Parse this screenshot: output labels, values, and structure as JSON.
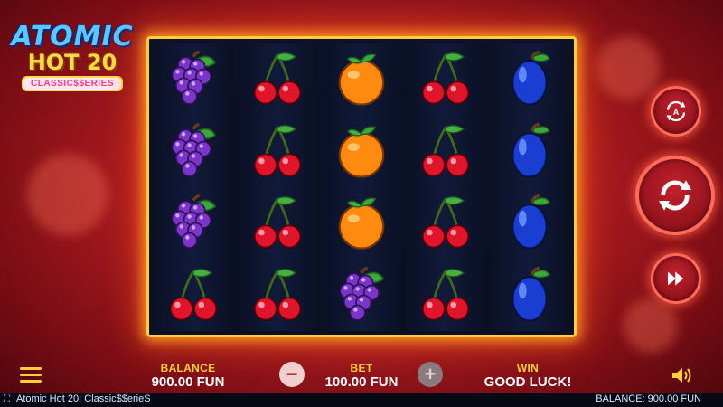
{
  "logo": {
    "line1": "ATOMIC",
    "line2": "HOT 20",
    "line3": "CLASSIC$$ERIES"
  },
  "reels": [
    [
      "grapes",
      "grapes",
      "grapes",
      "cherries"
    ],
    [
      "cherries",
      "cherries",
      "cherries",
      "cherries"
    ],
    [
      "orange",
      "orange",
      "orange",
      "grapes"
    ],
    [
      "cherries",
      "cherries",
      "cherries",
      "cherries"
    ],
    [
      "plum",
      "plum",
      "plum",
      "plum"
    ]
  ],
  "controls": {
    "autoplay_icon": "autoplay-icon",
    "spin_icon": "spin-icon",
    "turbo_icon": "fast-forward-icon"
  },
  "bottom": {
    "balance_label": "BALANCE",
    "balance_value": "900.00 FUN",
    "bet_label": "BET",
    "bet_value": "100.00 FUN",
    "win_label": "WIN",
    "win_value": "GOOD LUCK!",
    "minus": "−",
    "plus": "+"
  },
  "footer": {
    "title": "Atomic Hot 20: Classic$$erieS",
    "balance": "BALANCE: 900.00 FUN"
  },
  "colors": {
    "gold": "#ffcf3a",
    "red": "#b11d22",
    "reel_bg": "#0c1128"
  }
}
